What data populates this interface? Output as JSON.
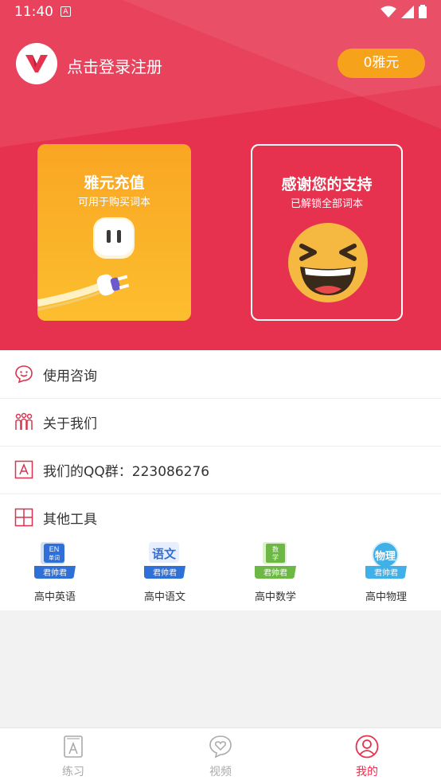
{
  "status": {
    "time": "11:40",
    "notif_letter": "A"
  },
  "header": {
    "login_text": "点击登录注册",
    "coins": "0雅元"
  },
  "cards": {
    "recharge": {
      "title": "雅元充值",
      "subtitle": "可用于购买词本"
    },
    "thanks": {
      "title": "感谢您的支持",
      "subtitle": "已解锁全部词本"
    }
  },
  "menu": {
    "items": [
      {
        "label": "使用咨询",
        "icon": "chat-smile-icon"
      },
      {
        "label": "关于我们",
        "icon": "people-icon"
      },
      {
        "label": "我们的QQ群：223086276",
        "icon": "letter-a-box-icon"
      },
      {
        "label": "其他工具",
        "icon": "grid-icon"
      }
    ]
  },
  "tools": [
    {
      "name": "高中英语",
      "badge": "EN\n单词",
      "brand": "君帅君",
      "color": "#2f6fd8"
    },
    {
      "name": "高中语文",
      "badge": "语文",
      "brand": "君帅君",
      "color": "#2f6fd8"
    },
    {
      "name": "高中数学",
      "badge": "数学",
      "brand": "君帅君",
      "color": "#6db845"
    },
    {
      "name": "高中物理",
      "badge": "物理",
      "brand": "君帅君",
      "color": "#3fb0e8"
    }
  ],
  "tabbar": {
    "tabs": [
      {
        "label": "练习",
        "icon": "book-a-icon",
        "active": false
      },
      {
        "label": "视频",
        "icon": "heart-bubble-icon",
        "active": false
      },
      {
        "label": "我的",
        "icon": "user-circle-icon",
        "active": true
      }
    ]
  },
  "colors": {
    "brand_red": "#e6324f",
    "orange": "#f7a21b",
    "inactive": "#aaaaaa"
  }
}
